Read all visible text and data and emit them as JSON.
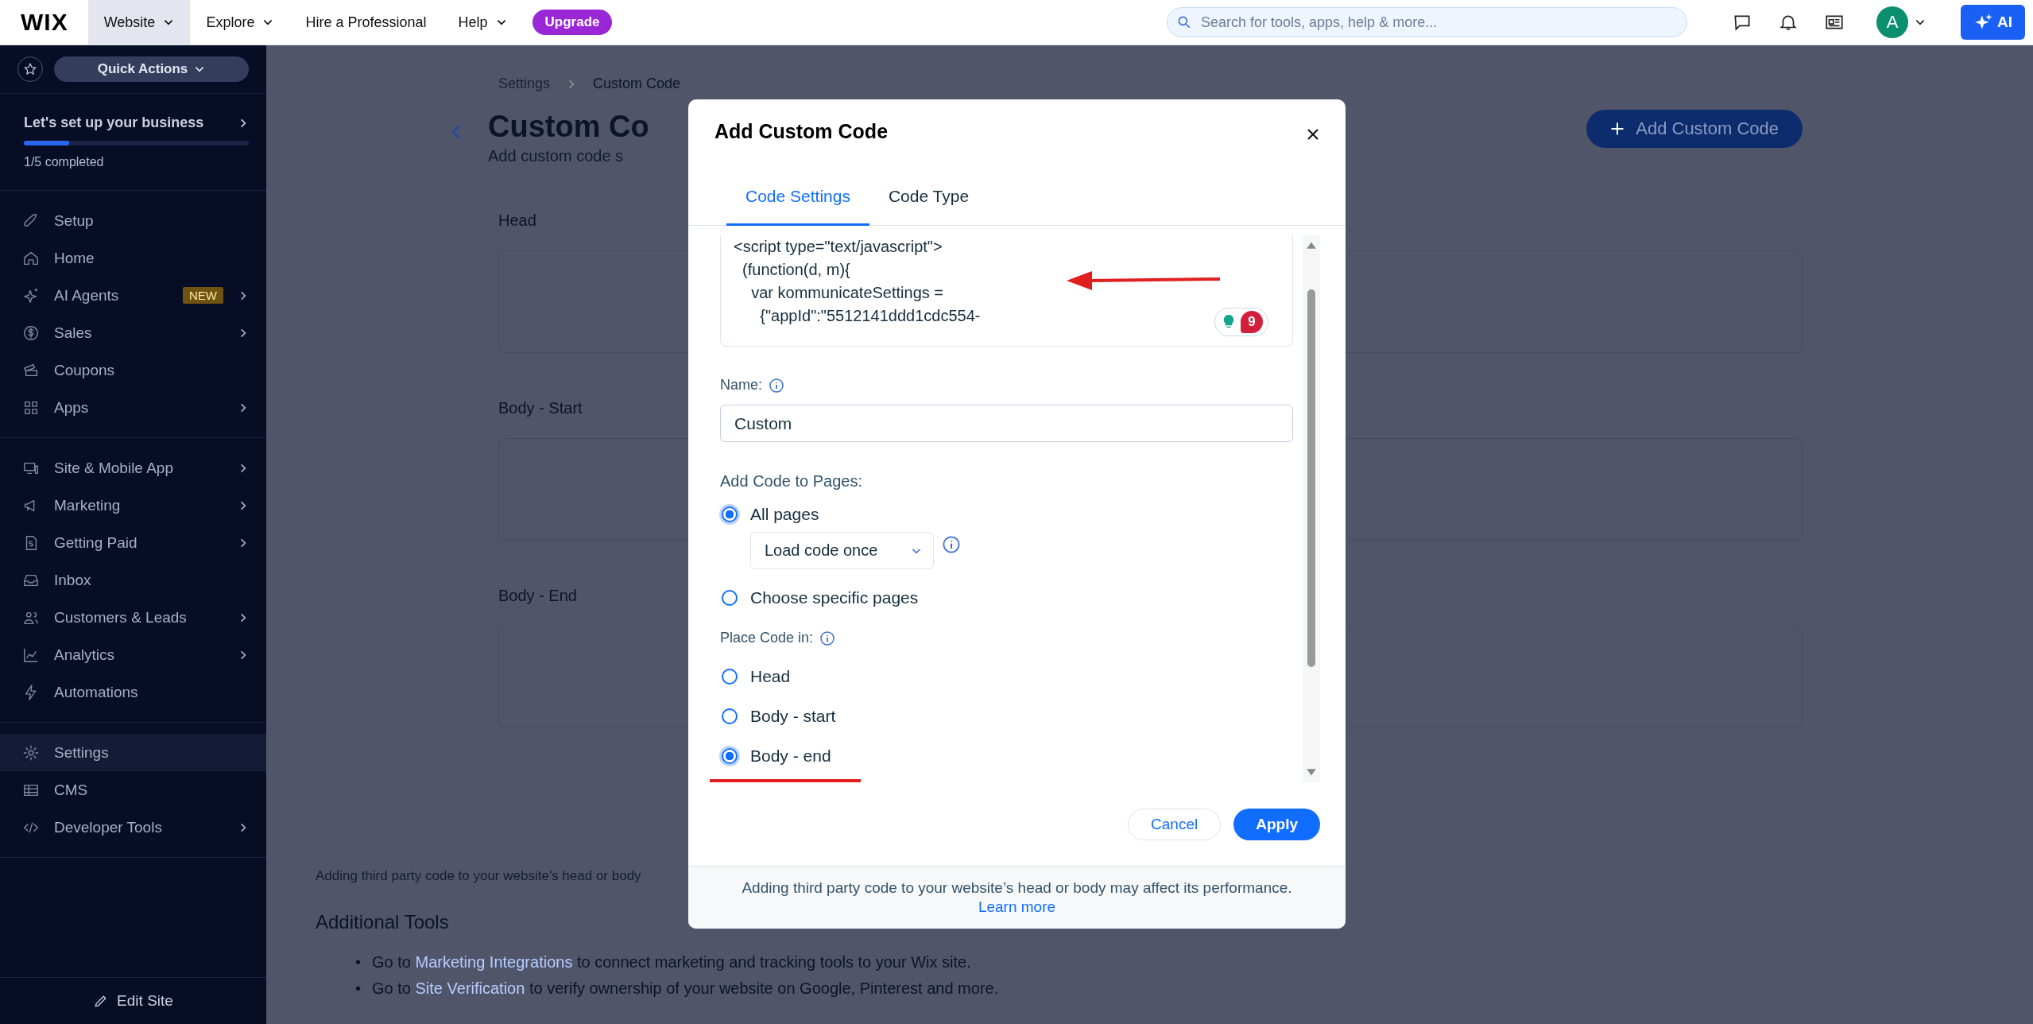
{
  "topbar": {
    "logo": "WIX",
    "nav": [
      {
        "label": "Website",
        "selected": true,
        "dropdown": true
      },
      {
        "label": "Explore",
        "selected": false,
        "dropdown": true
      },
      {
        "label": "Hire a Professional",
        "selected": false,
        "dropdown": false
      },
      {
        "label": "Help",
        "selected": false,
        "dropdown": true
      }
    ],
    "upgrade": "Upgrade",
    "search": {
      "placeholder": "Search for tools, apps, help & more..."
    },
    "avatar": "A",
    "ai_button": "AI"
  },
  "sidebar": {
    "quick_actions": "Quick Actions",
    "setup": {
      "title": "Let's set up your business",
      "level": 0.2,
      "progress": "1/5 completed"
    },
    "groups": [
      [
        {
          "label": "Setup",
          "chevron": false,
          "selected": false
        },
        {
          "label": "Home",
          "chevron": false,
          "selected": false
        },
        {
          "label": "AI Agents",
          "chevron": true,
          "selected": false,
          "badge": "NEW"
        },
        {
          "label": "Sales",
          "chevron": true,
          "selected": false
        },
        {
          "label": "Coupons",
          "chevron": false,
          "selected": false
        },
        {
          "label": "Apps",
          "chevron": true,
          "selected": false
        }
      ],
      [
        {
          "label": "Site & Mobile App",
          "chevron": true,
          "selected": false
        },
        {
          "label": "Marketing",
          "chevron": true,
          "selected": false
        },
        {
          "label": "Getting Paid",
          "chevron": true,
          "selected": false
        },
        {
          "label": "Inbox",
          "chevron": false,
          "selected": false
        },
        {
          "label": "Customers & Leads",
          "chevron": true,
          "selected": false
        },
        {
          "label": "Analytics",
          "chevron": true,
          "selected": false
        },
        {
          "label": "Automations",
          "chevron": false,
          "selected": false
        }
      ],
      [
        {
          "label": "Settings",
          "chevron": false,
          "selected": true
        },
        {
          "label": "CMS",
          "chevron": false,
          "selected": false
        },
        {
          "label": "Developer Tools",
          "chevron": true,
          "selected": false
        }
      ]
    ],
    "edit_site": "Edit Site"
  },
  "page": {
    "breadcrumb": [
      "Settings",
      "Custom Code"
    ],
    "title": "Custom Co",
    "subtitle": "Add custom code s",
    "add_button": "Add Custom Code",
    "sections": [
      "Head",
      "Body - Start",
      "Body - End"
    ],
    "note": "Adding third party code to your website's head or body",
    "tools_title": "Additional Tools",
    "tools": [
      {
        "marker": "•",
        "before": "Go to",
        "link": "Marketing Integrations",
        "after": "to connect marketing and tracking tools to your Wix site."
      },
      {
        "marker": "•",
        "before": "Go to",
        "link": "Site Verification",
        "after": "to verify ownership of your website on Google, Pinterest and more."
      }
    ]
  },
  "modal": {
    "title": "Add Custom Code",
    "tabs": [
      {
        "label": "Code Settings",
        "selected": true
      },
      {
        "label": "Code Type",
        "selected": false
      }
    ],
    "code_lines": [
      "<script type=\"text/javascript\">",
      "  (function(d, m){",
      "    var kommunicateSettings =",
      "      {\"appId\":\"5512141ddd1cdc554-"
    ],
    "badge_count": "9",
    "name_label": "Name:",
    "name_value": "Custom",
    "pages_label": "Add Code to Pages:",
    "page_options": [
      {
        "label": "All pages",
        "selected": true
      },
      {
        "label": "Choose specific pages",
        "selected": false
      }
    ],
    "load_select": "Load code once",
    "place_label": "Place Code in:",
    "place_options": [
      {
        "label": "Head",
        "selected": false
      },
      {
        "label": "Body - start",
        "selected": false
      },
      {
        "label": "Body - end",
        "selected": true
      }
    ],
    "cancel": "Cancel",
    "apply": "Apply",
    "footer_text": "Adding third party code to your website’s head or body may affect its performance.",
    "footer_link": "Learn more"
  }
}
